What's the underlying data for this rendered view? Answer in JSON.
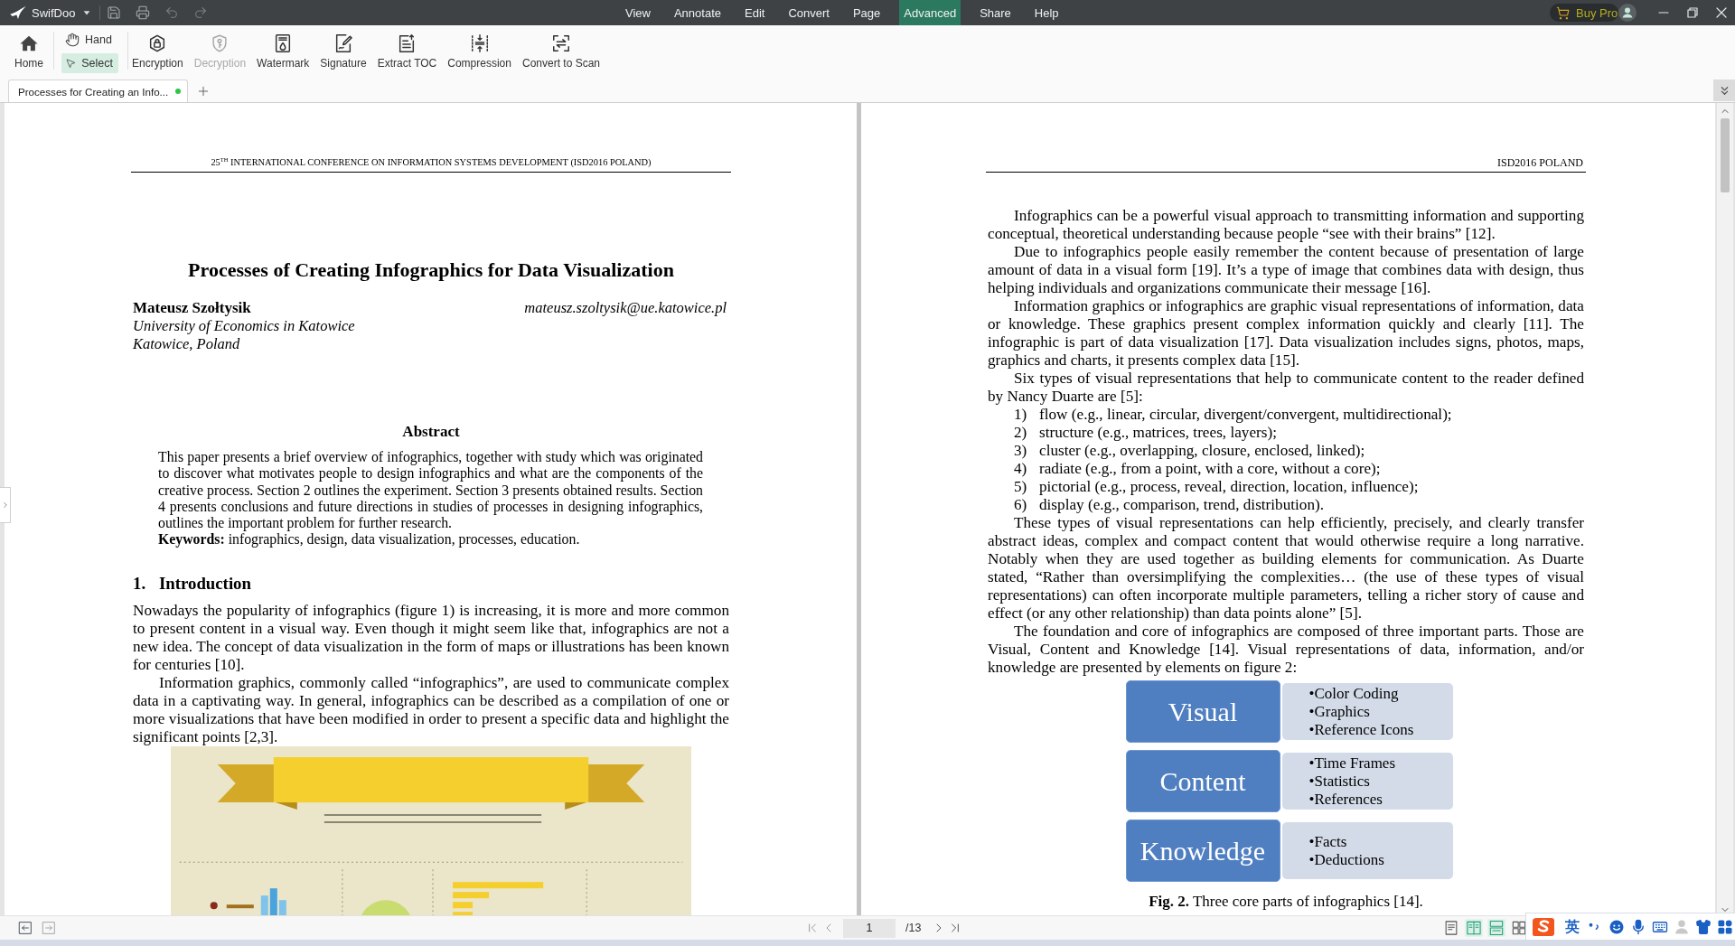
{
  "title_bar": {
    "app_name": "SwifDoo",
    "menu": [
      {
        "label": "View",
        "selected": false
      },
      {
        "label": "Annotate",
        "selected": false
      },
      {
        "label": "Edit",
        "selected": false
      },
      {
        "label": "Convert",
        "selected": false
      },
      {
        "label": "Page",
        "selected": false
      },
      {
        "label": "Advanced",
        "selected": true
      },
      {
        "label": "Share",
        "selected": false
      },
      {
        "label": "Help",
        "selected": false
      }
    ],
    "buy_pro": "Buy Pro"
  },
  "toolbar": {
    "home": "Home",
    "pointer_tools": [
      {
        "label": "Hand",
        "selected": false
      },
      {
        "label": "Select",
        "selected": true
      }
    ],
    "tools": [
      {
        "label": "Encryption",
        "disabled": false
      },
      {
        "label": "Decryption",
        "disabled": true
      },
      {
        "label": "Watermark",
        "disabled": false
      },
      {
        "label": "Signature",
        "disabled": false
      },
      {
        "label": "Extract TOC",
        "disabled": false
      },
      {
        "label": "Compression",
        "disabled": false
      },
      {
        "label": "Convert to Scan",
        "disabled": false
      }
    ]
  },
  "tabs": [
    {
      "label": "Processes for Creating an Info...",
      "selected": true
    }
  ],
  "left_page": {
    "running_header": "25$^{TH}$ INTERNATIONAL CONFERENCE ON INFORMATION SYSTEMS DEVELOPMENT (ISD2016 POLAND)",
    "title": "Processes of Creating Infographics for Data Visualization",
    "author": "Mateusz Szołtysik",
    "email": "mateusz.szoltysik@ue.katowice.pl",
    "affiliation": [
      "University of Economics in Katowice",
      "Katowice, Poland"
    ],
    "abstract_heading": "Abstract",
    "abstract": "This paper presents a brief overview of infographics, together with study which was originated to discover what motivates people to design infographics and what are the components of the creative process. Section 2 outlines the experiment. Section 3 presents obtained results. Section 4 presents conclusions and future directions in studies of processes in designing infographics, outlines the important problem for further research.",
    "keywords": "**Keywords:** infographics, design, data visualization, processes, education.",
    "section_number": "1.",
    "section_title": "Introduction",
    "paragraphs": [
      "Nowadays the popularity of infographics (figure 1) is increasing, it is more and more common to present content in a visual way. Even though it might seem like that, infographics are not a new idea. The concept of data visualization in the form of maps or illustrations has been known for centuries [10].",
      "Information graphics, commonly called “infographics”, are used to communicate complex data in a captivating way. In general, infographics can be described as a compilation of one or more visualizations that have been modified in order to present a specific data and highlight the significant points [2,3]."
    ]
  },
  "right_page": {
    "running_header": "ISD2016 POLAND",
    "blocks": [
      {
        "kind": "paragraph",
        "text": "Infographics can be a powerful visual approach to transmitting information and supporting conceptual, theoretical understanding because people “see with their brains” [12]."
      },
      {
        "kind": "paragraph",
        "text": "Due to infographics people easily remember the content because of presentation of large amount of data in a visual form [19]. It’s a type of image that combines data with design, thus helping individuals and organizations communicate their message [16]."
      },
      {
        "kind": "paragraph",
        "text": "Information graphics or infographics are graphic visual representations of information, data or knowledge. These graphics present complex information quickly and clearly [11]. The infographic is part of data visualization [17]. Data visualization includes signs, photos, maps, graphics and charts, it presents complex data [15]."
      },
      {
        "kind": "paragraph",
        "text": "Six types of visual representations that help to communicate content to the reader defined by Nancy Duarte are [5]:"
      },
      {
        "kind": "list_item",
        "number": "1)",
        "text": "flow (e.g., linear, circular, divergent/convergent, multidirectional);"
      },
      {
        "kind": "list_item",
        "number": "2)",
        "text": "structure (e.g., matrices, trees, layers);"
      },
      {
        "kind": "list_item",
        "number": "3)",
        "text": "cluster (e.g., overlapping, closure, enclosed, linked);"
      },
      {
        "kind": "list_item",
        "number": "4)",
        "text": "radiate (e.g., from a point, with a core, without a core);"
      },
      {
        "kind": "list_item",
        "number": "5)",
        "text": "pictorial (e.g., process, reveal, direction, location, influence);"
      },
      {
        "kind": "list_item",
        "number": "6)",
        "text": "display (e.g., comparison, trend, distribution)."
      },
      {
        "kind": "paragraph",
        "text": "These types of visual representations can help efficiently, precisely, and clearly transfer abstract ideas, complex and compact content that would otherwise require a long narrative. Notably when they are used together as building elements for communication. As Duarte stated, “Rather than oversimplifying the complexities… (the use of these types of visual representations) can often incorporate multiple parameters, telling a richer story of cause and effect (or any other relationship) than data points alone” [5]."
      },
      {
        "kind": "paragraph",
        "text": "The foundation and core of infographics are composed of three important parts. Those are Visual, Content and Knowledge [14]. Visual representations of data, information, and/or knowledge are presented by elements on figure 2:"
      }
    ],
    "figure": {
      "rows": [
        {
          "label": "Visual",
          "items": [
            "•Color Coding",
            "•Graphics",
            "•Reference Icons"
          ]
        },
        {
          "label": "Content",
          "items": [
            "•Time Frames",
            "•Statistics",
            "•References"
          ]
        },
        {
          "label": "Knowledge",
          "items": [
            "•Facts",
            "•Deductions"
          ]
        }
      ],
      "caption": "**Fig. 2.** Three core parts of infographics [14]."
    }
  },
  "status_bar": {
    "page_input": "1",
    "page_total": "/13"
  },
  "ime_bar": {
    "language": "英"
  }
}
